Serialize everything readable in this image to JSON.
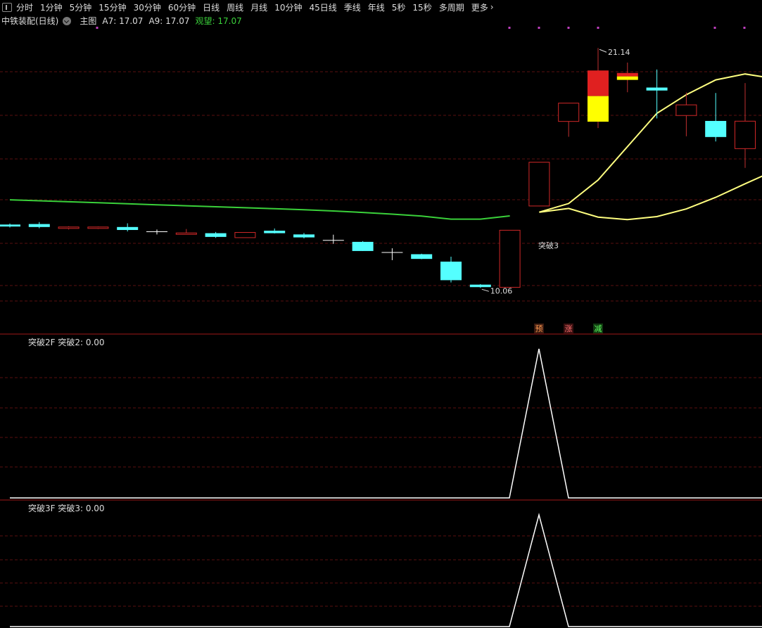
{
  "toolbar": {
    "items": [
      "分时",
      "1分钟",
      "5分钟",
      "15分钟",
      "30分钟",
      "60分钟",
      "日线",
      "周线",
      "月线",
      "10分钟",
      "45日线",
      "季线",
      "年线",
      "5秒",
      "15秒",
      "多周期",
      "更多"
    ]
  },
  "info": {
    "stock_name": "中铁装配(日线)",
    "main_label": "主图",
    "a7": "A7: 17.07",
    "a9": "A9: 17.07",
    "signal": "观望: 17.07"
  },
  "colors": {
    "up": "#e02020",
    "down": "#54ffff",
    "ma_green": "#3ad13a",
    "ma_yellow": "#ffff80",
    "grid": "#5a1010",
    "divider": "#a01818",
    "yellow_fill": "#ffff00"
  },
  "annotations": {
    "high_label": "21.14",
    "low_label": "10.06",
    "breakout_label": "突破3",
    "tags": [
      "预",
      "涨",
      "减"
    ]
  },
  "panels": {
    "sub1_label": "突破2F  突破2: 0.00",
    "sub2_label": "突破3F  突破3: 0.00"
  },
  "chart_data": {
    "type": "candlestick",
    "price_range": [
      9.6,
      22.0
    ],
    "candles": [
      {
        "o": 14.0,
        "c": 13.92,
        "h": 14.04,
        "l": 13.88,
        "dir": "down"
      },
      {
        "o": 13.9,
        "c": 14.02,
        "h": 14.1,
        "l": 13.85,
        "dir": "down"
      },
      {
        "o": 13.9,
        "c": 13.85,
        "h": 13.93,
        "l": 13.8,
        "dir": "up"
      },
      {
        "o": 13.9,
        "c": 13.85,
        "h": 13.92,
        "l": 13.82,
        "dir": "up"
      },
      {
        "o": 13.9,
        "c": 13.78,
        "h": 14.05,
        "l": 13.72,
        "dir": "down"
      },
      {
        "o": 13.71,
        "c": 13.66,
        "h": 13.8,
        "l": 13.6,
        "dir": "down"
      },
      {
        "o": 13.66,
        "c": 13.63,
        "h": 13.82,
        "l": 13.62,
        "dir": "up"
      },
      {
        "o": 13.65,
        "c": 13.5,
        "h": 13.7,
        "l": 13.46,
        "dir": "down"
      },
      {
        "o": 13.47,
        "c": 13.68,
        "h": 13.68,
        "l": 13.47,
        "dir": "up"
      },
      {
        "o": 13.75,
        "c": 13.65,
        "h": 13.84,
        "l": 13.64,
        "dir": "down"
      },
      {
        "o": 13.6,
        "c": 13.48,
        "h": 13.66,
        "l": 13.44,
        "dir": "down"
      },
      {
        "o": 13.36,
        "c": 13.32,
        "h": 13.59,
        "l": 13.22,
        "dir": "down"
      },
      {
        "o": 13.3,
        "c": 12.93,
        "h": 13.33,
        "l": 12.93,
        "dir": "down"
      },
      {
        "o": 12.87,
        "c": 12.84,
        "h": 13.04,
        "l": 12.56,
        "dir": "down"
      },
      {
        "o": 12.8,
        "c": 12.61,
        "h": 12.82,
        "l": 12.6,
        "dir": "down"
      },
      {
        "o": 12.5,
        "c": 11.75,
        "h": 12.7,
        "l": 11.66,
        "dir": "down"
      },
      {
        "o": 11.57,
        "c": 11.47,
        "h": 11.59,
        "l": 11.44,
        "dir": "down"
      },
      {
        "o": 11.46,
        "c": 13.77,
        "h": 13.77,
        "l": 11.46,
        "dir": "up"
      },
      {
        "o": 14.75,
        "c": 16.52,
        "h": 16.52,
        "l": 14.74,
        "dir": "up"
      },
      {
        "o": 18.17,
        "c": 18.91,
        "h": 18.91,
        "l": 17.55,
        "dir": "up"
      },
      {
        "o": 18.16,
        "c": 20.23,
        "h": 21.14,
        "l": 17.9,
        "dir": "up",
        "limit_up": true
      },
      {
        "o": 19.85,
        "c": 20.13,
        "h": 20.55,
        "l": 19.35,
        "dir": "up",
        "limit_up": true
      },
      {
        "o": 19.54,
        "c": 19.42,
        "h": 20.27,
        "l": 18.29,
        "dir": "down"
      },
      {
        "o": 18.41,
        "c": 18.84,
        "h": 19.34,
        "l": 17.57,
        "dir": "up"
      },
      {
        "o": 18.19,
        "c": 17.54,
        "h": 19.32,
        "l": 17.36,
        "dir": "down"
      },
      {
        "o": 17.07,
        "c": 18.18,
        "h": 19.72,
        "l": 16.29,
        "dir": "up"
      }
    ],
    "ma_green": [
      15.0,
      14.96,
      14.92,
      14.88,
      14.84,
      14.8,
      14.76,
      14.72,
      14.68,
      14.64,
      14.6,
      14.55,
      14.49,
      14.42,
      14.34,
      14.22,
      14.22,
      14.35
    ],
    "ma_yellow_upper": [
      14.5,
      14.85,
      15.8,
      17.15,
      18.5,
      19.25,
      19.85,
      20.09,
      19.9,
      19.62,
      19.35
    ],
    "ma_yellow_lower": [
      14.5,
      14.65,
      14.3,
      14.2,
      14.32,
      14.63,
      15.1,
      15.65,
      16.18,
      16.6
    ],
    "sub1": {
      "series_name": "突破2",
      "peak_index": 18,
      "values_peak": 1.0
    },
    "sub2": {
      "series_name": "突破3",
      "peak_index": 18,
      "values_peak": 1.0
    }
  }
}
